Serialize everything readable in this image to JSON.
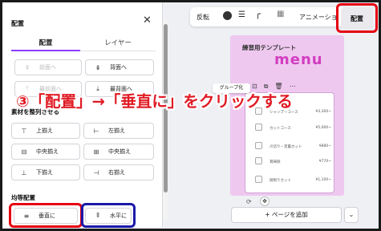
{
  "panel": {
    "title": "配置",
    "tabs": [
      {
        "label": "配置"
      },
      {
        "label": "レイヤー"
      }
    ],
    "order_buttons": [
      {
        "label": "前面へ",
        "enabled": false
      },
      {
        "label": "背面へ",
        "enabled": true
      },
      {
        "label": "最前面へ",
        "enabled": false
      },
      {
        "label": "最背面へ",
        "enabled": true
      }
    ],
    "align_section_title": "素材を整列させる",
    "align_buttons": [
      {
        "label": "上揃え"
      },
      {
        "label": "左揃え"
      },
      {
        "label": "中央揃え"
      },
      {
        "label": "中央揃え"
      },
      {
        "label": "下揃え"
      },
      {
        "label": "右揃え"
      }
    ],
    "distribute_section_title": "均等配置",
    "distribute_buttons": [
      {
        "label": "垂直に"
      },
      {
        "label": "水平に"
      }
    ]
  },
  "toolbar": {
    "flip_label": "反転",
    "animate_label": "アニメーショ",
    "arrange_label": "配置"
  },
  "canvas": {
    "card_title": "練習用テンプレート",
    "menu_word": "menu",
    "group_label": "グループ化",
    "rows": [
      {
        "name": "シャンプーコース",
        "price": "¥3,300~"
      },
      {
        "name": "カットコース",
        "price": "¥5,000~"
      },
      {
        "name": "爪切り・足裏カット",
        "price": "¥880~"
      },
      {
        "name": "耳掃除",
        "price": "¥770~"
      },
      {
        "name": "顔周りカット",
        "price": "¥1,100~"
      }
    ],
    "add_page_label": "+ ページを追加"
  },
  "instruction": "③「配置」→「垂直に」をクリックする",
  "colors": {
    "highlight_red": "#e60012",
    "highlight_blue": "#1a1aa8",
    "accent_purple": "#8b3dff",
    "card_pink": "#efc8f0",
    "instruction_red": "#e01b24"
  }
}
